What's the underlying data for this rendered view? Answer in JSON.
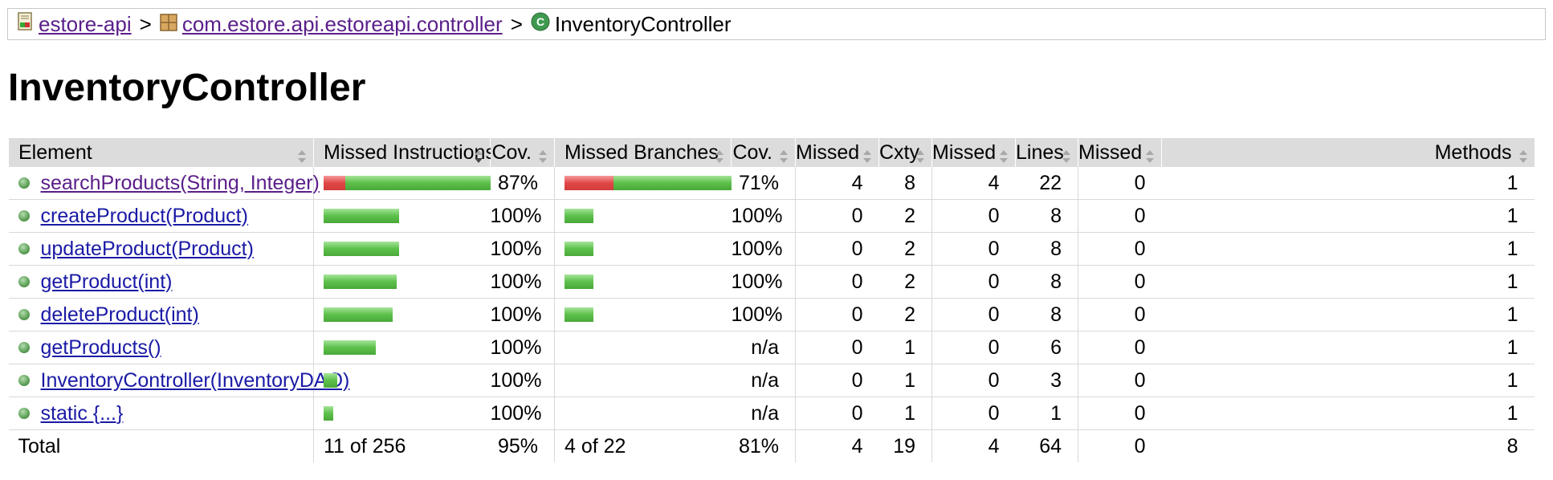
{
  "breadcrumb": {
    "items": [
      {
        "label": "estore-api",
        "icon": "report-icon"
      },
      {
        "label": "com.estore.api.estoreapi.controller",
        "icon": "package-icon"
      },
      {
        "label": "InventoryController",
        "icon": "class-icon"
      }
    ],
    "separator": ">"
  },
  "page_title": "InventoryController",
  "table": {
    "headers": {
      "element": "Element",
      "missed_instructions": "Missed Instructions",
      "cov_instr": "Cov.",
      "missed_branches": "Missed Branches",
      "cov_branch": "Cov.",
      "missed_cxty": "Missed",
      "cxty": "Cxty",
      "missed_lines": "Missed",
      "lines": "Lines",
      "missed_methods": "Missed",
      "methods": "Methods"
    },
    "rows": [
      {
        "element": "searchProducts(String, Integer)",
        "visited": true,
        "instr_missed_frac": 0.13,
        "instr_bar_scale": 1.0,
        "cov_instr": "87%",
        "branch_missed_frac": 0.29,
        "branch_bar_scale": 1.0,
        "cov_branch": "71%",
        "missed_cxty": "4",
        "cxty": "8",
        "missed_lines": "4",
        "lines": "22",
        "missed_methods": "0",
        "methods": "1"
      },
      {
        "element": "createProduct(Product)",
        "visited": false,
        "instr_missed_frac": 0,
        "instr_bar_scale": 0.39,
        "cov_instr": "100%",
        "branch_missed_frac": 0,
        "branch_bar_scale": 0.15,
        "cov_branch": "100%",
        "missed_cxty": "0",
        "cxty": "2",
        "missed_lines": "0",
        "lines": "8",
        "missed_methods": "0",
        "methods": "1"
      },
      {
        "element": "updateProduct(Product)",
        "visited": false,
        "instr_missed_frac": 0,
        "instr_bar_scale": 0.39,
        "cov_instr": "100%",
        "branch_missed_frac": 0,
        "branch_bar_scale": 0.15,
        "cov_branch": "100%",
        "missed_cxty": "0",
        "cxty": "2",
        "missed_lines": "0",
        "lines": "8",
        "missed_methods": "0",
        "methods": "1"
      },
      {
        "element": "getProduct(int)",
        "visited": false,
        "instr_missed_frac": 0,
        "instr_bar_scale": 0.38,
        "cov_instr": "100%",
        "branch_missed_frac": 0,
        "branch_bar_scale": 0.15,
        "cov_branch": "100%",
        "missed_cxty": "0",
        "cxty": "2",
        "missed_lines": "0",
        "lines": "8",
        "missed_methods": "0",
        "methods": "1"
      },
      {
        "element": "deleteProduct(int)",
        "visited": false,
        "instr_missed_frac": 0,
        "instr_bar_scale": 0.36,
        "cov_instr": "100%",
        "branch_missed_frac": 0,
        "branch_bar_scale": 0.15,
        "cov_branch": "100%",
        "missed_cxty": "0",
        "cxty": "2",
        "missed_lines": "0",
        "lines": "8",
        "missed_methods": "0",
        "methods": "1"
      },
      {
        "element": "getProducts()",
        "visited": false,
        "instr_missed_frac": 0,
        "instr_bar_scale": 0.27,
        "cov_instr": "100%",
        "branch_missed_frac": 0,
        "branch_bar_scale": 0,
        "cov_branch": "n/a",
        "missed_cxty": "0",
        "cxty": "1",
        "missed_lines": "0",
        "lines": "6",
        "missed_methods": "0",
        "methods": "1"
      },
      {
        "element": "InventoryController(InventoryDAO)",
        "visited": false,
        "instr_missed_frac": 0,
        "instr_bar_scale": 0.07,
        "cov_instr": "100%",
        "branch_missed_frac": 0,
        "branch_bar_scale": 0,
        "cov_branch": "n/a",
        "missed_cxty": "0",
        "cxty": "1",
        "missed_lines": "0",
        "lines": "3",
        "missed_methods": "0",
        "methods": "1"
      },
      {
        "element": "static {...}",
        "visited": false,
        "instr_missed_frac": 0,
        "instr_bar_scale": 0.05,
        "cov_instr": "100%",
        "branch_missed_frac": 0,
        "branch_bar_scale": 0,
        "cov_branch": "n/a",
        "missed_cxty": "0",
        "cxty": "1",
        "missed_lines": "0",
        "lines": "1",
        "missed_methods": "0",
        "methods": "1"
      }
    ],
    "total": {
      "label": "Total",
      "instructions": "11 of 256",
      "cov_instr": "95%",
      "branches": "4 of 22",
      "cov_branch": "81%",
      "missed_cxty": "4",
      "cxty": "19",
      "missed_lines": "4",
      "lines": "64",
      "missed_methods": "0",
      "methods": "8"
    }
  },
  "colors": {
    "covered_bar": "#5cc04a",
    "missed_bar": "#e04848",
    "header_bg": "#dcdcdc",
    "link": "#1a1aa6",
    "visited_link": "#5a1e8a"
  }
}
